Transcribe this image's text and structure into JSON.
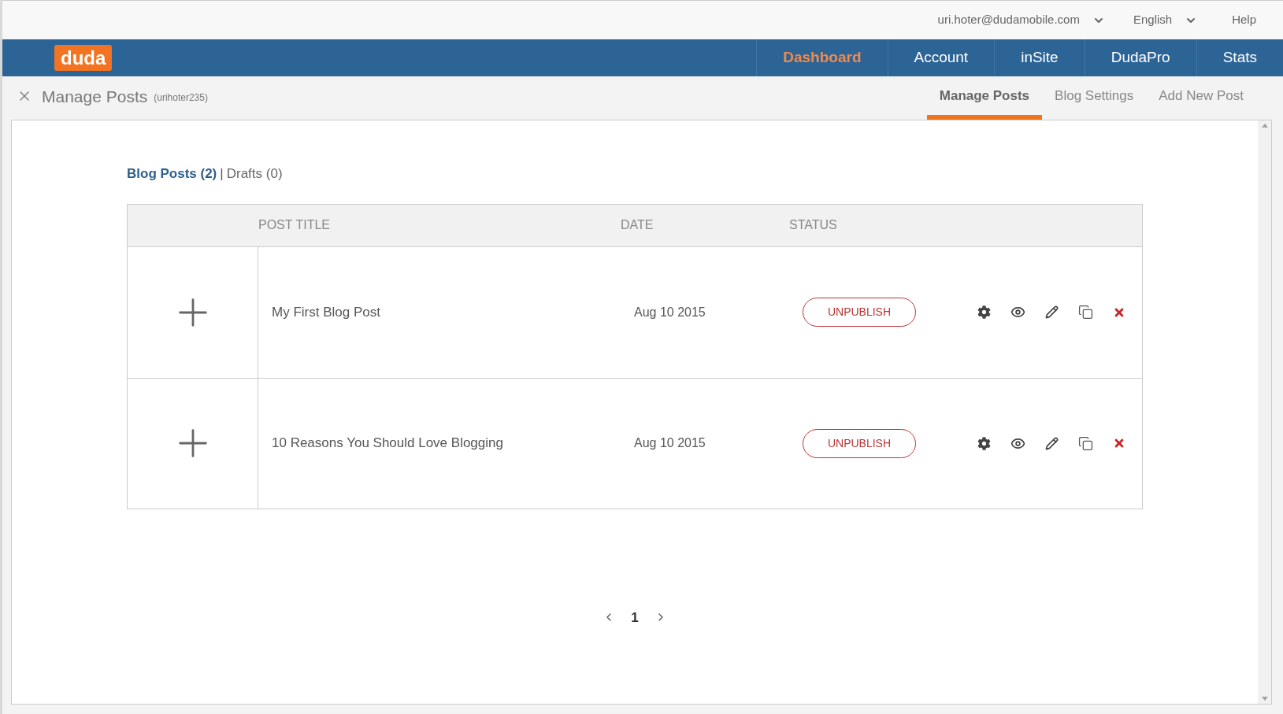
{
  "top_bar": {
    "account": "uri.hoter@dudamobile.com",
    "language": "English",
    "help": "Help"
  },
  "logo": "duda",
  "nav": [
    {
      "label": "Dashboard",
      "selected": true
    },
    {
      "label": "Account",
      "selected": false
    },
    {
      "label": "inSite",
      "selected": false
    },
    {
      "label": "DudaPro",
      "selected": false
    },
    {
      "label": "Stats",
      "selected": false
    }
  ],
  "page_header": {
    "title": "Manage Posts",
    "subtitle": "(urihoter235)"
  },
  "sub_tabs": [
    {
      "label": "Manage Posts",
      "selected": true
    },
    {
      "label": "Blog Settings",
      "selected": false
    },
    {
      "label": "Add New Post",
      "selected": false
    }
  ],
  "filters": [
    {
      "label": "Blog Posts (2)",
      "selected": true
    },
    {
      "label": "Drafts (0)",
      "selected": false
    }
  ],
  "filter_separator": "|",
  "table": {
    "columns": [
      "POST TITLE",
      "DATE",
      "STATUS"
    ],
    "rows": [
      {
        "title": "My First Blog Post",
        "date": "Aug 10 2015",
        "status": "UNPUBLISH"
      },
      {
        "title": "10 Reasons You Should Love Blogging",
        "date": "Aug 10 2015",
        "status": "UNPUBLISH"
      }
    ]
  },
  "pagination": {
    "pages": [
      {
        "label": "1",
        "selected": true
      }
    ]
  }
}
